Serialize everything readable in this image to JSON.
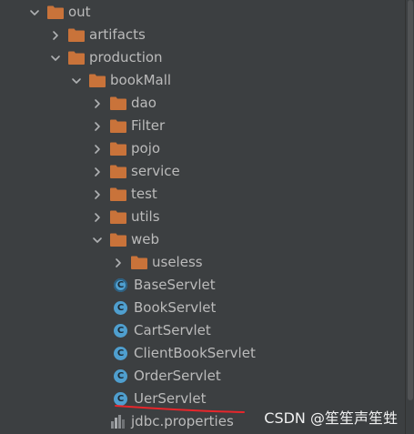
{
  "tree": {
    "items": [
      {
        "label": "out",
        "type": "folder",
        "depth": 0,
        "state": "expanded"
      },
      {
        "label": "artifacts",
        "type": "folder",
        "depth": 1,
        "state": "collapsed"
      },
      {
        "label": "production",
        "type": "folder",
        "depth": 1,
        "state": "expanded"
      },
      {
        "label": "bookMall",
        "type": "folder",
        "depth": 2,
        "state": "expanded"
      },
      {
        "label": "dao",
        "type": "folder",
        "depth": 3,
        "state": "collapsed"
      },
      {
        "label": "Filter",
        "type": "folder",
        "depth": 3,
        "state": "collapsed"
      },
      {
        "label": "pojo",
        "type": "folder",
        "depth": 3,
        "state": "collapsed"
      },
      {
        "label": "service",
        "type": "folder",
        "depth": 3,
        "state": "collapsed"
      },
      {
        "label": "test",
        "type": "folder",
        "depth": 3,
        "state": "collapsed"
      },
      {
        "label": "utils",
        "type": "folder",
        "depth": 3,
        "state": "collapsed"
      },
      {
        "label": "web",
        "type": "folder",
        "depth": 3,
        "state": "expanded"
      },
      {
        "label": "useless",
        "type": "folder",
        "depth": 4,
        "state": "collapsed"
      },
      {
        "label": "BaseServlet",
        "type": "abstract-class",
        "depth": 4,
        "state": "leaf"
      },
      {
        "label": "BookServlet",
        "type": "class",
        "depth": 4,
        "state": "leaf"
      },
      {
        "label": "CartServlet",
        "type": "class",
        "depth": 4,
        "state": "leaf"
      },
      {
        "label": "ClientBookServlet",
        "type": "class",
        "depth": 4,
        "state": "leaf"
      },
      {
        "label": "OrderServlet",
        "type": "class",
        "depth": 4,
        "state": "leaf"
      },
      {
        "label": "UerServlet",
        "type": "class",
        "depth": 4,
        "state": "leaf"
      },
      {
        "label": "jdbc.properties",
        "type": "properties",
        "depth": 3,
        "state": "leaf"
      }
    ]
  },
  "icons": {
    "expanded": "chevron-down-icon",
    "collapsed": "chevron-right-icon",
    "folder": "folder-icon",
    "class": "java-class-icon",
    "abstract-class": "java-abstract-class-icon",
    "properties": "properties-file-icon",
    "class_letter": "C"
  },
  "colors": {
    "background": "#3c3f41",
    "text": "#bbbbbb",
    "folder": "#c9733a",
    "class_icon": "#4f9fcf",
    "annotation_line": "#e8262b"
  },
  "watermark": "CSDN @笙笙声笙甡"
}
